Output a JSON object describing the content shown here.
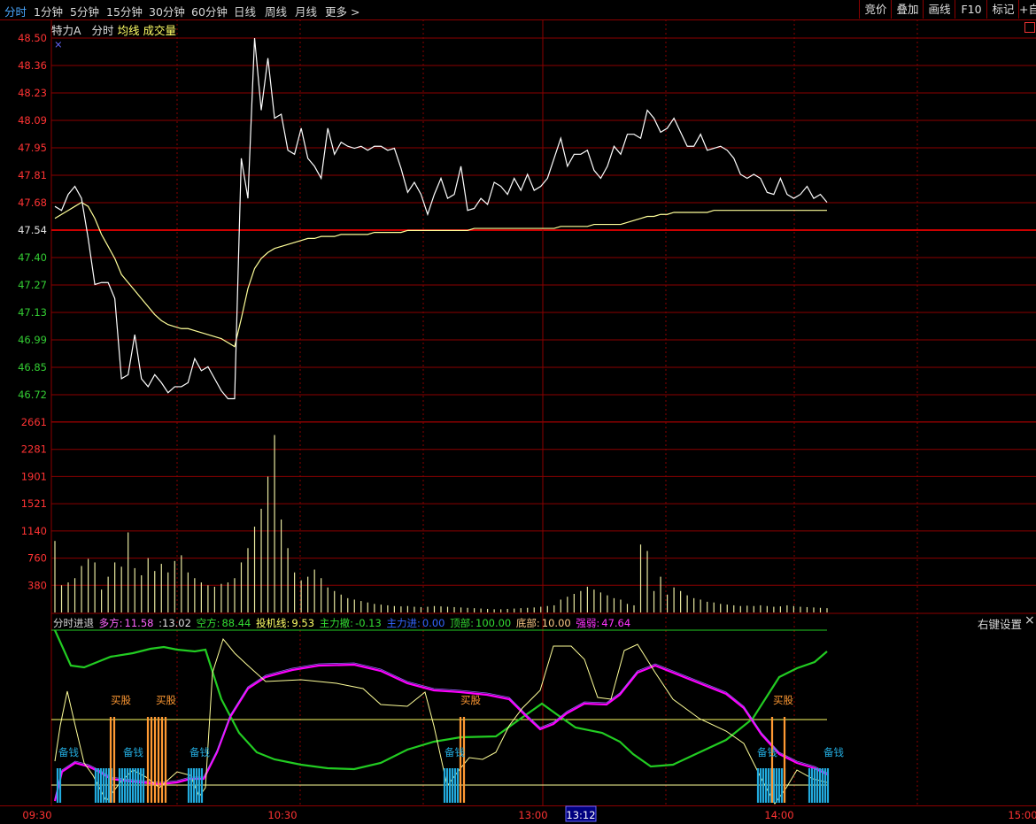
{
  "toolbar": {
    "periods": [
      "分时",
      "1分钟",
      "5分钟",
      "15分钟",
      "30分钟",
      "60分钟",
      "日线",
      "周线",
      "月线",
      "更多 >"
    ],
    "active_period": "分时",
    "right_buttons": [
      "竞价",
      "叠加",
      "画线",
      "F10",
      "标记",
      "+自"
    ]
  },
  "symbol": {
    "name": "特力A",
    "mode": "分时",
    "avg_label": "均线",
    "volume_label": "成交量"
  },
  "colors": {
    "price_up": "#ff3333",
    "price_down": "#33cc33",
    "grid": "#8b0000",
    "price_line": "#ffffff",
    "avg_line": "#ffff99",
    "green_line": "#22cc22",
    "magenta_line": "#ff00ff",
    "buy_bar": "#ff9933",
    "cash_bar": "#22aadd"
  },
  "indicator": {
    "name": "分时进退",
    "duofang_label": "多方:",
    "duofang_value": "11.58",
    "extra_value": ":13.02",
    "kongfang_label": "空方:",
    "kongfang_value": "88.44",
    "touji_label": "投机线:",
    "touji_value": "9.53",
    "zhulisan_label": "主力撤:",
    "zhulisan_value": "-0.13",
    "zhulijin_label": "主力进:",
    "zhulijin_value": "0.00",
    "dingbu_label": "顶部:",
    "dingbu_value": "100.00",
    "dibu_label": "底部:",
    "dibu_value": "10.00",
    "qiangruo_label": "强弱:",
    "qiangruo_value": "47.64",
    "right_click_settings": "右键设置",
    "close": "×",
    "buy_signal": "买股",
    "cash_signal": "备钱"
  },
  "chart_data": {
    "type": "line",
    "price_axis": {
      "ticks": [
        "48.50",
        "48.36",
        "48.23",
        "48.09",
        "47.95",
        "47.81",
        "47.68",
        "47.54",
        "47.40",
        "47.27",
        "47.13",
        "46.99",
        "46.85",
        "46.72"
      ],
      "prev_close": 47.54,
      "ylim": [
        46.72,
        48.5
      ]
    },
    "volume_axis": {
      "ticks": [
        "2661",
        "2281",
        "1901",
        "1521",
        "1140",
        "760",
        "380"
      ],
      "ylim": [
        0,
        2661
      ]
    },
    "time_labels": [
      "09:30",
      "10:30",
      "13:00",
      "14:00",
      "15:00"
    ],
    "cursor_time": "13:12",
    "price": [
      47.66,
      47.64,
      47.72,
      47.76,
      47.7,
      47.5,
      47.27,
      47.28,
      47.28,
      47.2,
      46.8,
      46.82,
      47.02,
      46.8,
      46.76,
      46.82,
      46.78,
      46.73,
      46.76,
      46.76,
      46.78,
      46.9,
      46.84,
      46.86,
      46.8,
      46.74,
      46.7,
      46.7,
      47.9,
      47.7,
      48.5,
      48.14,
      48.4,
      48.1,
      48.12,
      47.94,
      47.92,
      48.05,
      47.9,
      47.86,
      47.8,
      48.05,
      47.92,
      47.98,
      47.96,
      47.95,
      47.96,
      47.94,
      47.96,
      47.96,
      47.94,
      47.95,
      47.85,
      47.73,
      47.78,
      47.72,
      47.62,
      47.72,
      47.8,
      47.7,
      47.72,
      47.86,
      47.64,
      47.65,
      47.7,
      47.67,
      47.78,
      47.76,
      47.72,
      47.8,
      47.74,
      47.82,
      47.74,
      47.76,
      47.8,
      47.9,
      48.0,
      47.86,
      47.92,
      47.92,
      47.94,
      47.84,
      47.8,
      47.86,
      47.96,
      47.92,
      48.02,
      48.02,
      48.0,
      48.14,
      48.1,
      48.03,
      48.05,
      48.1,
      48.03,
      47.96,
      47.96,
      48.02,
      47.94,
      47.95,
      47.96,
      47.94,
      47.9,
      47.82,
      47.8,
      47.82,
      47.8,
      47.73,
      47.72,
      47.8,
      47.72,
      47.7,
      47.72,
      47.76,
      47.7,
      47.72,
      47.68
    ],
    "avg": [
      47.6,
      47.62,
      47.64,
      47.66,
      47.68,
      47.66,
      47.6,
      47.52,
      47.46,
      47.4,
      47.32,
      47.28,
      47.24,
      47.2,
      47.16,
      47.12,
      47.09,
      47.07,
      47.06,
      47.05,
      47.05,
      47.04,
      47.03,
      47.02,
      47.01,
      47.0,
      46.98,
      46.96,
      47.1,
      47.25,
      47.35,
      47.4,
      47.43,
      47.45,
      47.46,
      47.47,
      47.48,
      47.49,
      47.5,
      47.5,
      47.51,
      47.51,
      47.51,
      47.52,
      47.52,
      47.52,
      47.52,
      47.52,
      47.53,
      47.53,
      47.53,
      47.53,
      47.53,
      47.54,
      47.54,
      47.54,
      47.54,
      47.54,
      47.54,
      47.54,
      47.54,
      47.54,
      47.54,
      47.55,
      47.55,
      47.55,
      47.55,
      47.55,
      47.55,
      47.55,
      47.55,
      47.55,
      47.55,
      47.55,
      47.55,
      47.55,
      47.56,
      47.56,
      47.56,
      47.56,
      47.56,
      47.57,
      47.57,
      47.57,
      47.57,
      47.57,
      47.58,
      47.59,
      47.6,
      47.61,
      47.61,
      47.62,
      47.62,
      47.63,
      47.63,
      47.63,
      47.63,
      47.63,
      47.63,
      47.64,
      47.64,
      47.64,
      47.64,
      47.64,
      47.64,
      47.64,
      47.64,
      47.64,
      47.64,
      47.64,
      47.64,
      47.64,
      47.64,
      47.64,
      47.64,
      47.64,
      47.64
    ],
    "volume": [
      1000,
      380,
      420,
      480,
      650,
      750,
      700,
      320,
      500,
      700,
      640,
      1120,
      620,
      520,
      760,
      580,
      680,
      560,
      720,
      800,
      560,
      480,
      420,
      380,
      360,
      400,
      420,
      480,
      700,
      900,
      1200,
      1450,
      1900,
      2481,
      1300,
      900,
      560,
      450,
      500,
      600,
      480,
      350,
      300,
      250,
      200,
      180,
      160,
      140,
      120,
      110,
      100,
      90,
      85,
      90,
      80,
      75,
      80,
      90,
      85,
      80,
      75,
      70,
      65,
      60,
      55,
      50,
      45,
      45,
      50,
      55,
      60,
      65,
      70,
      80,
      90,
      100,
      180,
      220,
      260,
      300,
      360,
      320,
      280,
      240,
      200,
      180,
      120,
      100,
      950,
      860,
      300,
      500,
      250,
      350,
      300,
      240,
      200,
      180,
      150,
      140,
      120,
      110,
      100,
      90,
      95,
      90,
      100,
      90,
      80,
      85,
      100,
      90,
      80,
      75,
      70,
      65,
      60
    ]
  }
}
